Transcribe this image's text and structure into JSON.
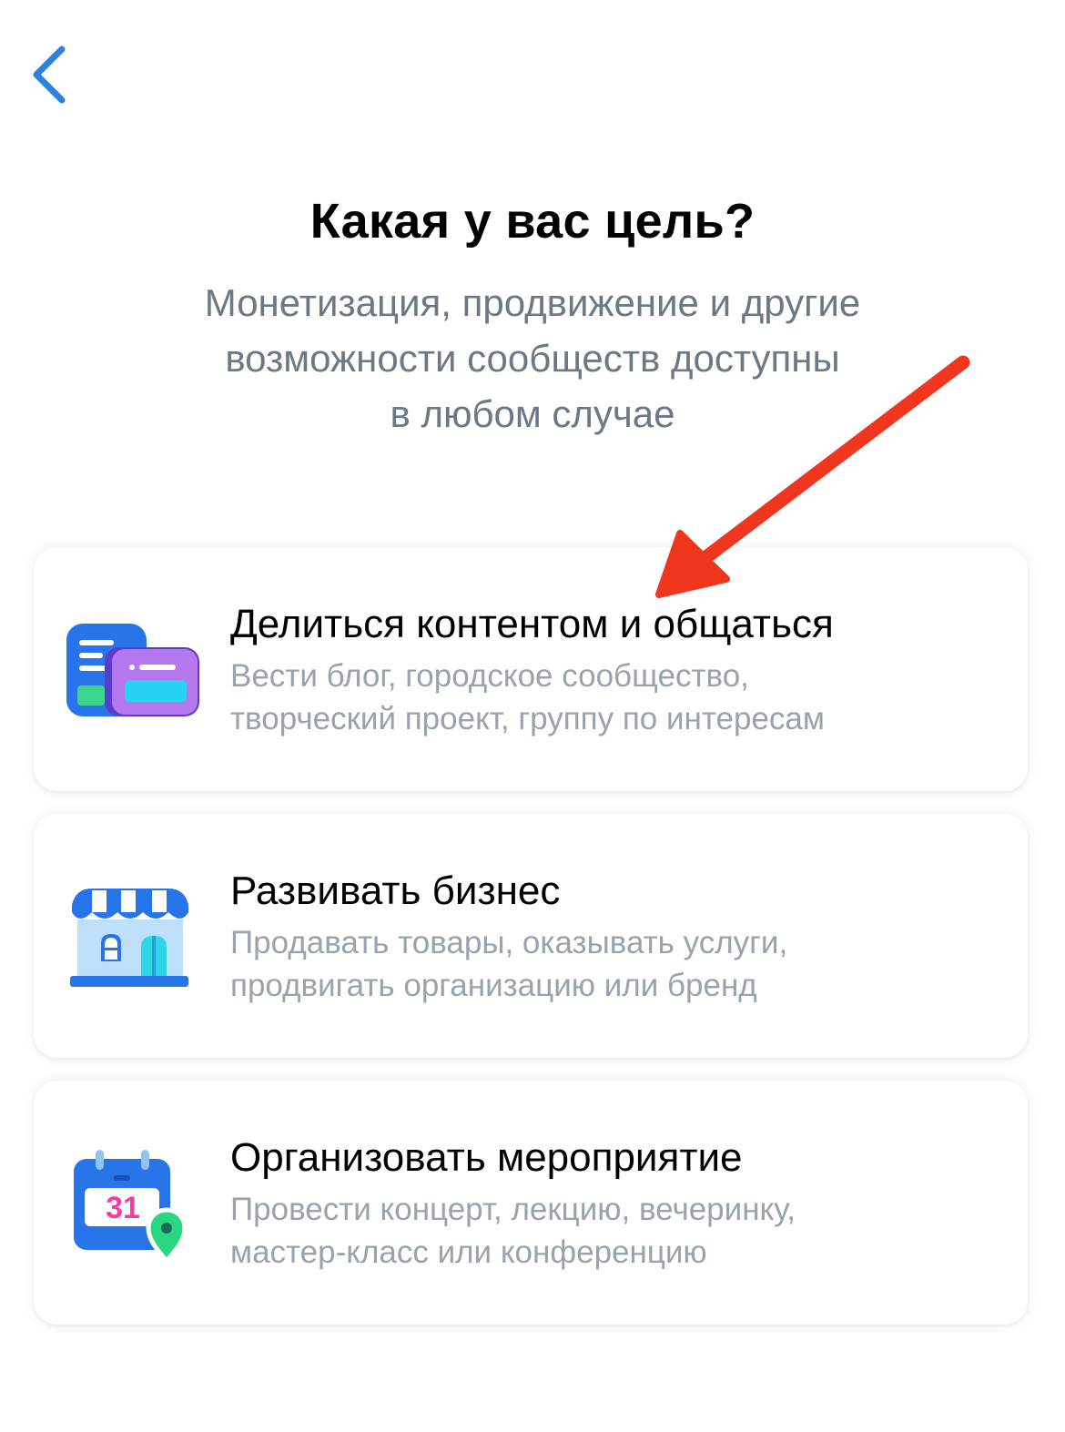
{
  "header": {
    "back_icon": "chevron-left-icon",
    "title": "Какая у вас цель?",
    "subtitle_lines": [
      "Монетизация, продвижение и другие",
      "возможности сообществ доступны",
      "в любом случае"
    ]
  },
  "options": [
    {
      "icon": "content-share-icon",
      "title": "Делиться контентом и общаться",
      "desc_lines": [
        "Вести блог, городское сообщество,",
        "творческий проект, группу по интересам"
      ]
    },
    {
      "icon": "storefront-icon",
      "title": "Развивать бизнес",
      "desc_lines": [
        "Продавать товары, оказывать услуги,",
        "продвигать организацию или бренд"
      ]
    },
    {
      "icon": "calendar-event-icon",
      "calendar_day": "31",
      "title": "Организовать мероприятие",
      "desc_lines": [
        "Провести концерт, лекцию, вечеринку,",
        "мастер-класс или конференцию"
      ]
    }
  ],
  "annotation": {
    "icon": "red-arrow-icon",
    "color": "#f2361e"
  },
  "colors": {
    "accent": "#2d81e0",
    "title": "#000000",
    "secondary": "#6d7885",
    "tertiary": "#99a2ad"
  }
}
